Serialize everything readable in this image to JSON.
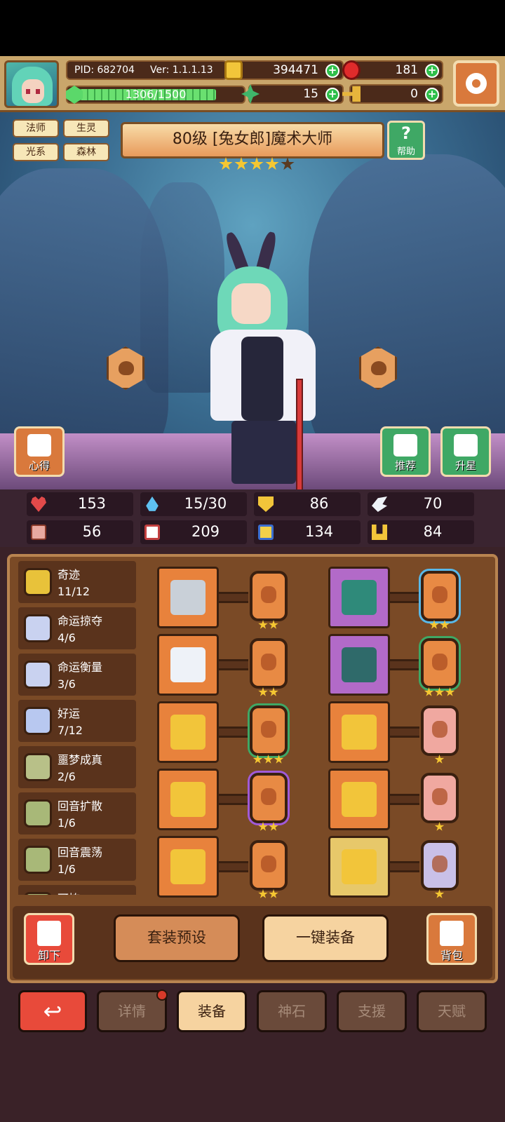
{
  "player": {
    "pid": "PID: 682704",
    "version": "Ver: 1.1.1.13",
    "energy": "1306/1500",
    "energy_fraction": 0.871
  },
  "resources": {
    "coins": "394471",
    "gems": "181",
    "clovers": "15",
    "keys": "0"
  },
  "character": {
    "tags": [
      "法师",
      "生灵",
      "光系",
      "森林"
    ],
    "title": "80级 [兔女郎]魔术大师",
    "stars_filled": 4,
    "stars_total": 5,
    "help_label": "帮助",
    "notes_label": "心得",
    "recommend_label": "推荐",
    "star_up_label": "升星"
  },
  "stats": [
    {
      "icon": "heart-icon",
      "value": "153"
    },
    {
      "icon": "mana-drop-icon",
      "value": "15/30"
    },
    {
      "icon": "shield-icon",
      "value": "86"
    },
    {
      "icon": "wing-icon",
      "value": "70"
    },
    {
      "icon": "fist-icon",
      "value": "56"
    },
    {
      "icon": "book-icon",
      "value": "209"
    },
    {
      "icon": "boot-icon",
      "value": "134"
    },
    {
      "icon": "horseshoe-icon",
      "value": "84"
    }
  ],
  "sets": [
    {
      "name": "奇迹",
      "progress": "11/12",
      "color": "#e8c23a"
    },
    {
      "name": "命运掠夺",
      "progress": "4/6",
      "color": "#c9d2f0"
    },
    {
      "name": "命运衡量",
      "progress": "3/6",
      "color": "#c9d2f0"
    },
    {
      "name": "好运",
      "progress": "7/12",
      "color": "#b8c8f0"
    },
    {
      "name": "噩梦成真",
      "progress": "2/6",
      "color": "#b8c088"
    },
    {
      "name": "回音扩散",
      "progress": "1/6",
      "color": "#a8b878"
    },
    {
      "name": "回音震荡",
      "progress": "1/6",
      "color": "#a8b878"
    },
    {
      "name": "可怖",
      "progress": "",
      "color": "#a8b878"
    }
  ],
  "equipment": [
    {
      "item": "axe",
      "slot_color": "orange",
      "rune_color": "plain",
      "stars": 2
    },
    {
      "item": "crown",
      "slot_color": "purple",
      "rune_color": "blue",
      "stars": 2
    },
    {
      "item": "orb",
      "slot_color": "orange",
      "rune_color": "plain",
      "stars": 2
    },
    {
      "item": "armor",
      "slot_color": "purple",
      "rune_color": "green",
      "stars": 3
    },
    {
      "item": "necklace",
      "slot_color": "orange",
      "rune_color": "green",
      "stars": 3
    },
    {
      "item": "bracer",
      "slot_color": "orange",
      "rune_color": "pink",
      "stars": 1
    },
    {
      "item": "amulet",
      "slot_color": "orange",
      "rune_color": "purple",
      "stars": 2
    },
    {
      "item": "ring",
      "slot_color": "orange",
      "rune_color": "pink",
      "stars": 1
    },
    {
      "item": "ring-gold",
      "slot_color": "orange",
      "rune_color": "plain",
      "stars": 2
    },
    {
      "item": "boots",
      "slot_color": "gold",
      "rune_color": "lavender",
      "stars": 1
    }
  ],
  "actions": {
    "unequip_label": "卸下",
    "preset_label": "套装预设",
    "auto_equip_label": "一键装备",
    "bag_label": "背包"
  },
  "tabs": [
    {
      "label": "",
      "icon": "back-arrow-icon"
    },
    {
      "label": "详情"
    },
    {
      "label": "装备"
    },
    {
      "label": "神石"
    },
    {
      "label": "支援"
    },
    {
      "label": "天赋"
    }
  ],
  "colors": {
    "panel": "#7a4a26",
    "accent_green": "#3fa865",
    "accent_orange": "#d9793c",
    "back_red": "#e84a3a"
  }
}
